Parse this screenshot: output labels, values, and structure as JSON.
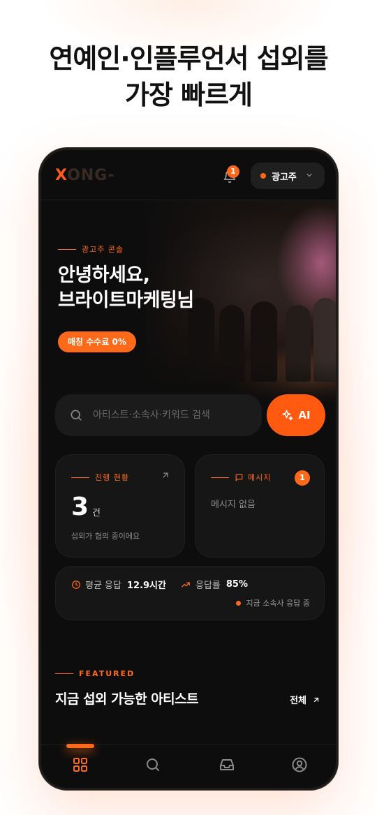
{
  "promo": {
    "headline_line1": "연예인·인플루언서 섭외를",
    "headline_line2": "가장 빠르게"
  },
  "app": {
    "logo_x": "X",
    "logo_rest": "ONG-",
    "notification_count": "1",
    "role_label": "광고주"
  },
  "hero": {
    "kicker": "광고주 콘솔",
    "greeting_line1": "안녕하세요,",
    "greeting_line2": "브라이트마케팅님",
    "fee_badge": "매칭 수수료 0%"
  },
  "search": {
    "placeholder": "아티스트·소속사·키워드 검색",
    "ai_label": "AI"
  },
  "progress_card": {
    "kicker": "진행 현황",
    "count": "3",
    "unit": "건",
    "description": "섭외가 협의 중이에요"
  },
  "message_card": {
    "kicker": "메시지",
    "badge": "1",
    "empty_text": "메시지 없음"
  },
  "stats": {
    "avg_response_label": "평균 응답",
    "avg_response_value": "12.9시간",
    "response_rate_label": "응답률",
    "response_rate_value": "85%",
    "live_text": "지금 소속사 응답 중"
  },
  "featured": {
    "kicker": "FEATURED",
    "title": "지금 섭외 가능한 아티스트",
    "see_all": "전체"
  },
  "tabs": {
    "icons": [
      "grid-icon",
      "search-icon",
      "inbox-icon",
      "profile-icon"
    ],
    "active_color": "#ff6a1a"
  },
  "colors": {
    "accent": "#ff6a1a",
    "background": "#0d0d0d",
    "card": "#161616"
  }
}
